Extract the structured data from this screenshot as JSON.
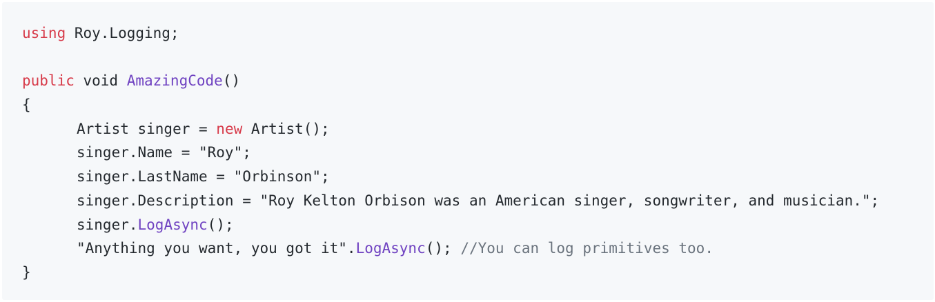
{
  "code": {
    "line1": {
      "keyword": "using",
      "rest": " Roy.Logging;"
    },
    "line3": {
      "keyword": "public",
      "mid": " void ",
      "func": "AmazingCode",
      "end": "()"
    },
    "line4": {
      "text": "{"
    },
    "line5": {
      "pre": "Artist singer = ",
      "keyword": "new",
      "post": " Artist();"
    },
    "line6": {
      "text": "singer.Name = \"Roy\";"
    },
    "line7": {
      "text": "singer.LastName = \"Orbinson\";"
    },
    "line8": {
      "text": "singer.Description = \"Roy Kelton Orbison was an American singer, songwriter, and musician.\";"
    },
    "line9": {
      "pre": "singer.",
      "func": "LogAsync",
      "post": "();"
    },
    "line10": {
      "pre": "\"Anything you want, you got it\".",
      "func": "LogAsync",
      "post": "(); ",
      "comment": "//You can log primitives too."
    },
    "line11": {
      "text": "}"
    }
  },
  "colors": {
    "background": "#f6f8fa",
    "keyword": "#d73a49",
    "function": "#6f42c1",
    "comment": "#6a737d",
    "text": "#24292e"
  }
}
